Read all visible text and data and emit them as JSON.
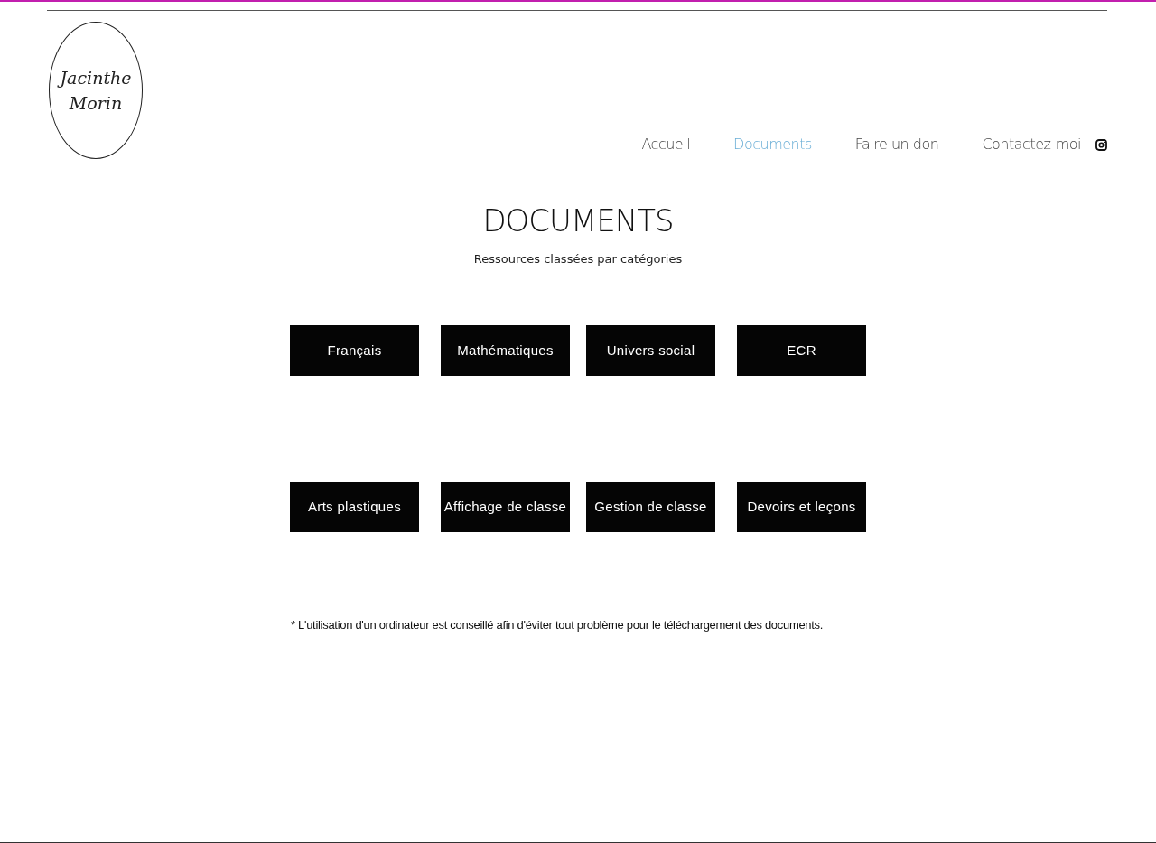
{
  "logo": {
    "lines": [
      "Jacinthe",
      "Morin"
    ]
  },
  "nav": [
    {
      "label": "Accueil",
      "selected": false
    },
    {
      "label": "Documents",
      "selected": true
    },
    {
      "label": "Faire un don",
      "selected": false
    },
    {
      "label": "Contactez-moi",
      "selected": false
    }
  ],
  "title": "DOCUMENTS",
  "subtitle": "Ressources classées par catégories",
  "category_rows": [
    [
      "Français",
      "Mathématiques",
      "Univers social",
      "ECR"
    ],
    [
      "Arts plastiques",
      "Affichage de classe",
      "Gestion de classe",
      "Devoirs et leçons"
    ]
  ],
  "note": "* L'utilisation d'un ordinateur est conseillé afin d'éviter tout problème pour le téléchargement des documents."
}
